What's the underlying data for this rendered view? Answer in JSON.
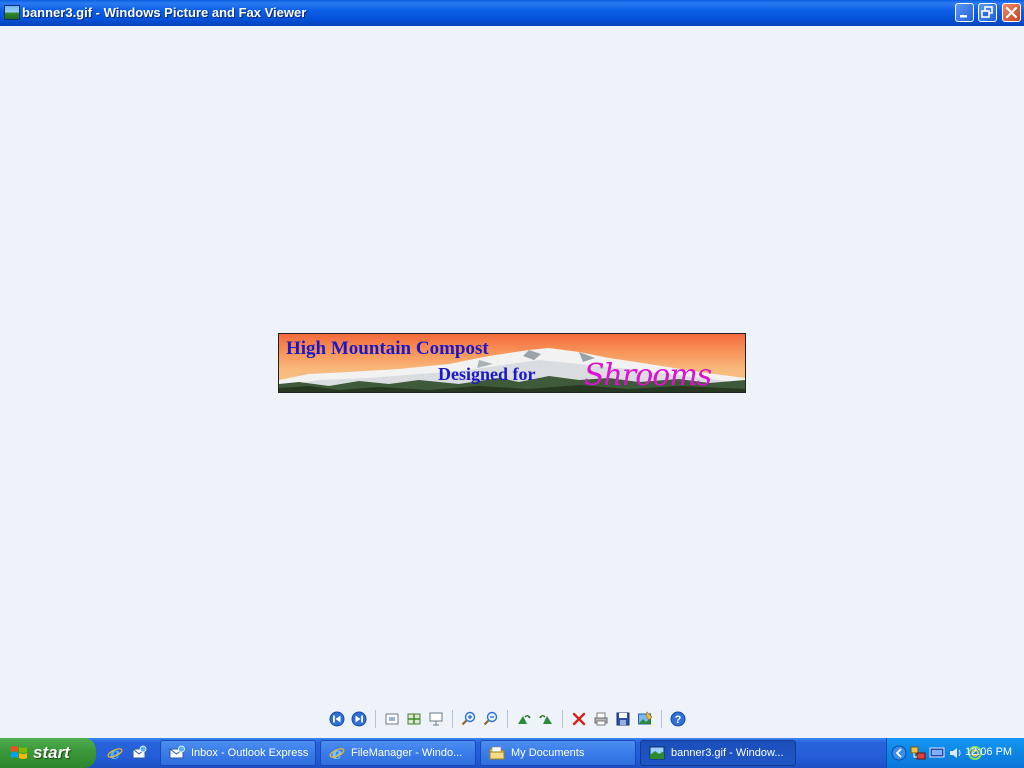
{
  "window": {
    "title": "banner3.gif - Windows Picture and Fax Viewer",
    "icon": "picture-viewer-icon",
    "buttons": [
      "minimize-icon",
      "restore-icon",
      "close-icon"
    ]
  },
  "image": {
    "filename": "banner3.gif",
    "line1": "High Mountain Compost",
    "line2": "Designed for",
    "script_text": "Shrooms"
  },
  "toolbar": {
    "tools": [
      {
        "name": "previous-image",
        "icon": "previous-icon"
      },
      {
        "name": "next-image",
        "icon": "next-icon"
      },
      {
        "name": "best-fit",
        "icon": "best-fit-icon"
      },
      {
        "name": "actual-size",
        "icon": "actual-size-icon"
      },
      {
        "name": "slide-show",
        "icon": "slideshow-icon"
      },
      {
        "name": "zoom-in",
        "icon": "zoom-in-icon"
      },
      {
        "name": "zoom-out",
        "icon": "zoom-out-icon"
      },
      {
        "name": "rotate-clockwise",
        "icon": "rotate-clockwise-icon"
      },
      {
        "name": "rotate-counterclockwise",
        "icon": "rotate-counterclockwise-icon"
      },
      {
        "name": "delete",
        "icon": "delete-icon"
      },
      {
        "name": "print",
        "icon": "print-icon"
      },
      {
        "name": "save-copy",
        "icon": "save-icon"
      },
      {
        "name": "edit",
        "icon": "edit-icon"
      },
      {
        "name": "help",
        "icon": "help-icon"
      }
    ]
  },
  "taskbar": {
    "start_label": "start",
    "quick_launch": [
      "internet-explorer-icon",
      "outlook-express-icon"
    ],
    "tasks": [
      {
        "label": "Inbox - Outlook Express",
        "icon": "outlook-express-icon",
        "active": false
      },
      {
        "label": "FileManager - Windo...",
        "icon": "internet-explorer-icon",
        "active": false
      },
      {
        "label": "My Documents",
        "icon": "folder-icon",
        "active": false
      },
      {
        "label": "banner3.gif - Window...",
        "icon": "picture-viewer-icon",
        "active": true
      }
    ],
    "tray_icons": [
      "show-hidden-icons-chevron",
      "network-icon",
      "display-icon",
      "volume-icon",
      "sync-icon"
    ],
    "clock": "12:06 PM"
  },
  "colors": {
    "titlebar": "#0b5fe6",
    "canvas_bg": "#eef3fa",
    "taskbar": "#245ed8",
    "start_button": "#3c9a3a",
    "banner_text": "#1a18c8",
    "banner_script": "#e010d0"
  }
}
